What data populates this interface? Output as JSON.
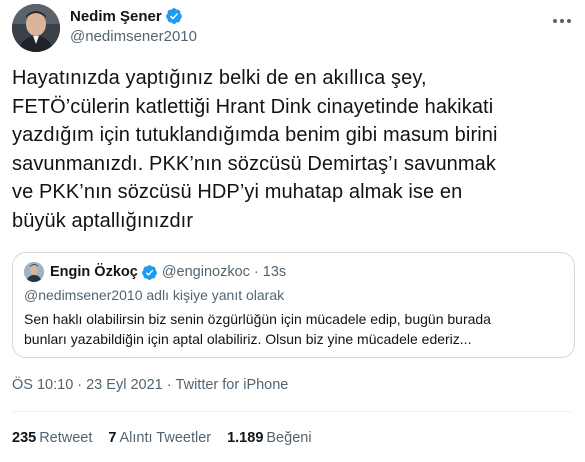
{
  "author": {
    "name": "Nedim Şener",
    "handle": "@nedimsener2010",
    "verified": true
  },
  "tweet": {
    "lines": [
      "Hayatınızda yaptığınız belki de en akıllıca şey,",
      "FETÖ’cülerin katlettiği Hrant Dink cinayetinde hakikati",
      "yazdığım için tutuklandığımda benim gibi masum birini",
      "savunmanızdı. PKK’nın sözcüsü Demirtaş’ı savunmak",
      "ve PKK’nın sözcüsü HDP’yi muhatap almak ise en",
      "büyük aptallığınızdır"
    ]
  },
  "quote": {
    "name": "Engin Özkoç",
    "handle": "@enginozkoc",
    "time": "13s",
    "reply_to": "@nedimsener2010 adlı kişiye yanıt olarak",
    "lines": [
      "Sen haklı olabilirsin biz senin özgürlüğün için mücadele edip, bugün burada",
      "bunları yazabildiğin için aptal olabiliriz. Olsun biz yine mücadele ederiz..."
    ]
  },
  "meta": {
    "time": "ÖS 10:10",
    "date": "23 Eyl 2021",
    "source": "Twitter for iPhone",
    "separator": "·"
  },
  "stats": {
    "retweets_count": "235",
    "retweets_label": "Retweet",
    "quotes_count": "7",
    "quotes_label": "Alıntı Tweetler",
    "likes_count": "1.189",
    "likes_label": "Beğeni"
  },
  "colors": {
    "verified": "#1d9bf0",
    "secondary_text": "#536471",
    "border": "#cfd9de"
  },
  "icons": {
    "verified": "verified-badge-icon",
    "more": "more-options-icon"
  }
}
